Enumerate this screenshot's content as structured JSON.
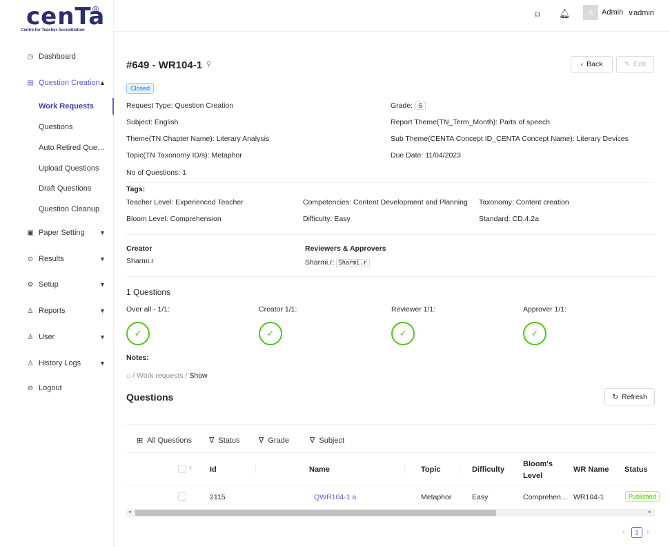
{
  "logo": {
    "word": "cenTa",
    "registered": "®",
    "subtitle": "Centre for Teacher Accreditation"
  },
  "sidebar": {
    "items": [
      {
        "label": "Dashboard",
        "icon": "dashboard-icon"
      },
      {
        "label": "Question Creation",
        "icon": "book-icon"
      },
      {
        "label": "Paper Setting",
        "icon": "paper-icon"
      },
      {
        "label": "Results",
        "icon": "check-circle-icon"
      },
      {
        "label": "Setup",
        "icon": "gear-icon"
      },
      {
        "label": "Reports",
        "icon": "user-icon"
      },
      {
        "label": "User",
        "icon": "user-icon"
      },
      {
        "label": "History Logs",
        "icon": "user-icon"
      },
      {
        "label": "Logout",
        "icon": "logout-icon"
      }
    ],
    "sub_items": [
      "Work Requests",
      "Questions",
      "Auto Retired Questi...",
      "Upload Questions",
      "Draft Questions",
      "Question Cleanup"
    ]
  },
  "header": {
    "user_name": "Admin",
    "user_role": "admin"
  },
  "page": {
    "title": "#649 - WR104-1",
    "status": "Closed",
    "back_label": "Back",
    "edit_label": "Edit"
  },
  "details": {
    "request_type_label": "Request Type:",
    "request_type": "Question Creation",
    "subject_label": "Subject:",
    "subject": "English",
    "theme_label": "Theme(TN Chapter Name):",
    "theme": "Literary Analysis",
    "topic_label": "Topic(TN Taxonomy ID/s):",
    "topic": "Metaphor",
    "noq_label": "No of Questions:",
    "noq": "1",
    "grade_label": "Grade:",
    "grade": "5",
    "report_theme_label": "Report Theme(TN_Term_Month):",
    "report_theme": "Parts of speech",
    "sub_theme_label": "Sub Theme(CENTA Concept ID_CENTA Concept Name):",
    "sub_theme": "Literary Devices",
    "due_date_label": "Due Date:",
    "due_date": "11/04/2023"
  },
  "tags": {
    "heading": "Tags:",
    "teacher_level_label": "Teacher Level:",
    "teacher_level": "Experienced Teacher",
    "competencies_label": "Competencies:",
    "competencies": "Content Development and Planning",
    "taxonomy_label": "Taxonomy:",
    "taxonomy": "Content creation",
    "bloom_label": "Bloom Level:",
    "bloom": "Comprehension",
    "difficulty_label": "Difficulty:",
    "difficulty": "Easy",
    "standard_label": "Standard:",
    "standard": "CD.4.2a"
  },
  "people": {
    "creator_heading": "Creator",
    "creator": "Sharmi.r",
    "reviewers_heading": "Reviewers & Approvers",
    "reviewer_name": "Sharmi.r:",
    "reviewer_code": "Sharmi.r"
  },
  "progress": {
    "heading": "1 Questions",
    "overall": "Over all - 1/1:",
    "creator": "Creator 1/1:",
    "reviewer": "Reviewer 1/1:",
    "approver": "Approver 1/1:",
    "notes": "Notes:"
  },
  "breadcrumb": {
    "sep": "/",
    "work_requests": "Work requests",
    "show": "Show"
  },
  "questions": {
    "title": "Questions",
    "refresh_label": "Refresh",
    "filters": [
      "All Questions",
      "Status",
      "Grade",
      "Subject"
    ],
    "columns": [
      "Id",
      "Name",
      "Topic",
      "Difficulty",
      "Bloom's Level",
      "WR Name",
      "Status"
    ],
    "rows": [
      {
        "id": "2115",
        "name": "QWR104-1 a",
        "topic": "Metaphor",
        "difficulty": "Easy",
        "bloom": "Comprehen...",
        "wr_name": "WR104-1",
        "status": "Published"
      }
    ],
    "page": "1"
  }
}
